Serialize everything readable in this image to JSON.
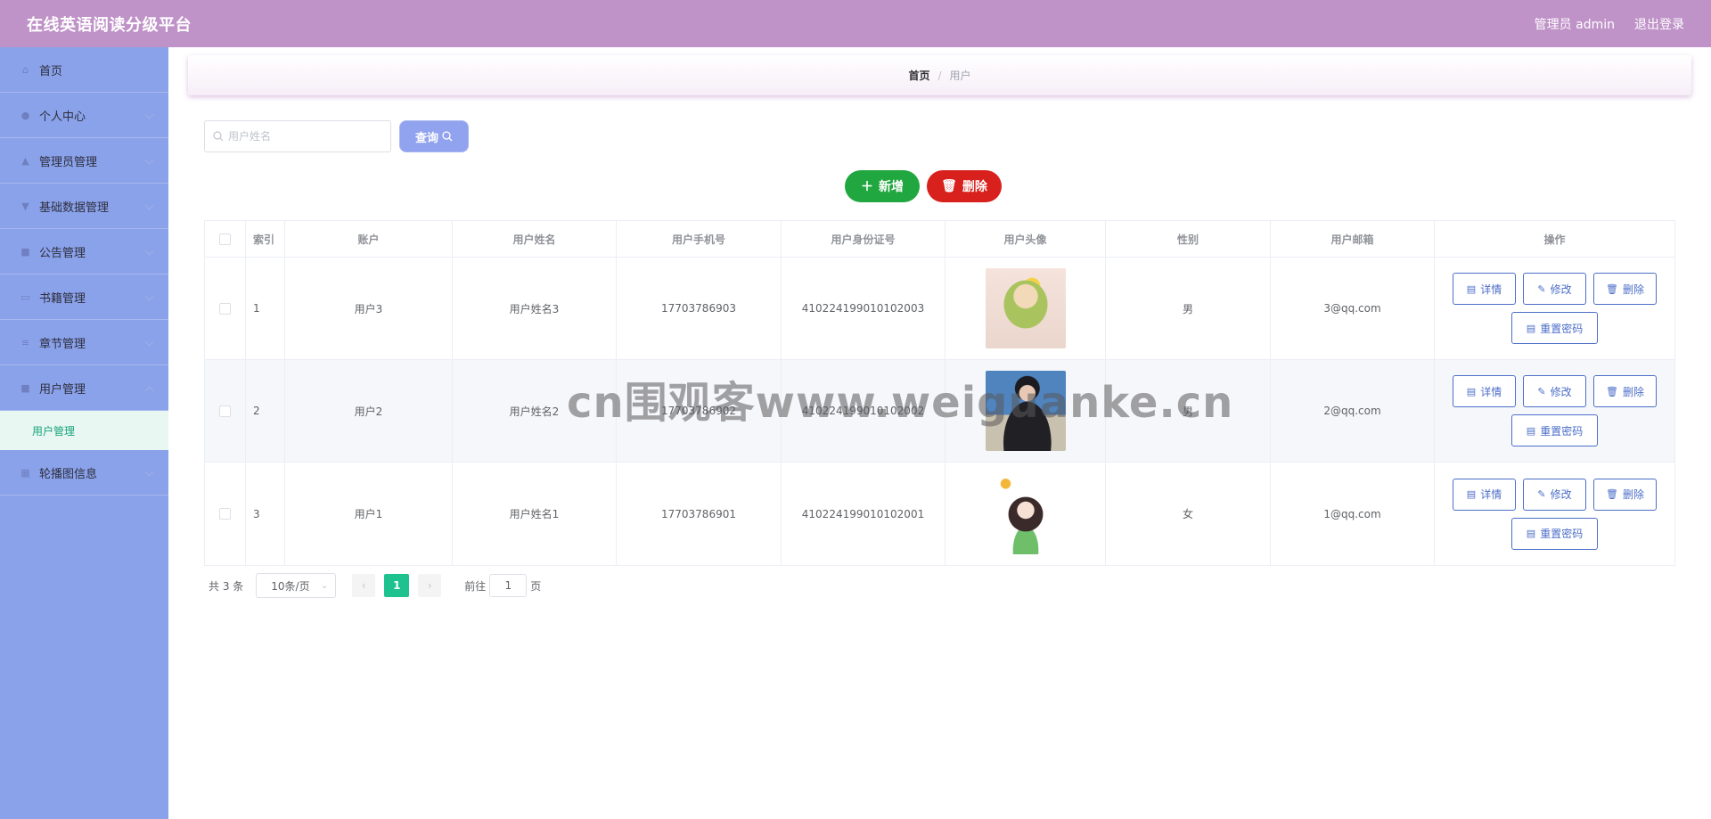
{
  "header": {
    "title": "在线英语阅读分级平台",
    "user_label": "管理员 admin",
    "logout_label": "退出登录"
  },
  "sidebar": {
    "items": [
      {
        "label": "首页",
        "icon": "home-icon"
      },
      {
        "label": "个人中心",
        "icon": "user-icon"
      },
      {
        "label": "管理员管理",
        "icon": "thumbs-up-icon"
      },
      {
        "label": "基础数据管理",
        "icon": "data-icon"
      },
      {
        "label": "公告管理",
        "icon": "notice-icon"
      },
      {
        "label": "书籍管理",
        "icon": "book-icon"
      },
      {
        "label": "章节管理",
        "icon": "list-icon"
      },
      {
        "label": "用户管理",
        "icon": "clipboard-icon"
      },
      {
        "label": "轮播图信息",
        "icon": "image-icon"
      }
    ],
    "sub_item": "用户管理"
  },
  "breadcrumb": {
    "home": "首页",
    "separator": "/",
    "current": "用户"
  },
  "search": {
    "placeholder": "用户姓名",
    "button": "查询"
  },
  "actions": {
    "add": "新增",
    "delete": "删除"
  },
  "table": {
    "headers": [
      "索引",
      "账户",
      "用户姓名",
      "用户手机号",
      "用户身份证号",
      "用户头像",
      "性别",
      "用户邮箱",
      "操作"
    ],
    "rows": [
      {
        "index": "1",
        "account": "用户3",
        "name": "用户姓名3",
        "phone": "17703786903",
        "id_card": "410224199010102003",
        "gender": "男",
        "email": "3@qq.com"
      },
      {
        "index": "2",
        "account": "用户2",
        "name": "用户姓名2",
        "phone": "17703786902",
        "id_card": "410224199010102002",
        "gender": "男",
        "email": "2@qq.com"
      },
      {
        "index": "3",
        "account": "用户1",
        "name": "用户姓名1",
        "phone": "17703786901",
        "id_card": "410224199010102001",
        "gender": "女",
        "email": "1@qq.com"
      }
    ],
    "ops": {
      "detail": "详情",
      "edit": "修改",
      "delete": "删除",
      "reset": "重置密码"
    }
  },
  "pagination": {
    "total": "共 3 条",
    "page_size": "10条/页",
    "current_page": "1",
    "goto_prefix": "前往",
    "goto_value": "1",
    "goto_suffix": "页"
  },
  "watermark": "cn围观客www.weiguanke.cn",
  "colors": {
    "topbar": "#bf92c8",
    "sidebar": "#8aa2ea",
    "add": "#21a73f",
    "delete": "#d8201c",
    "active_page": "#1dc28e",
    "op_border": "#4c6ec8"
  }
}
